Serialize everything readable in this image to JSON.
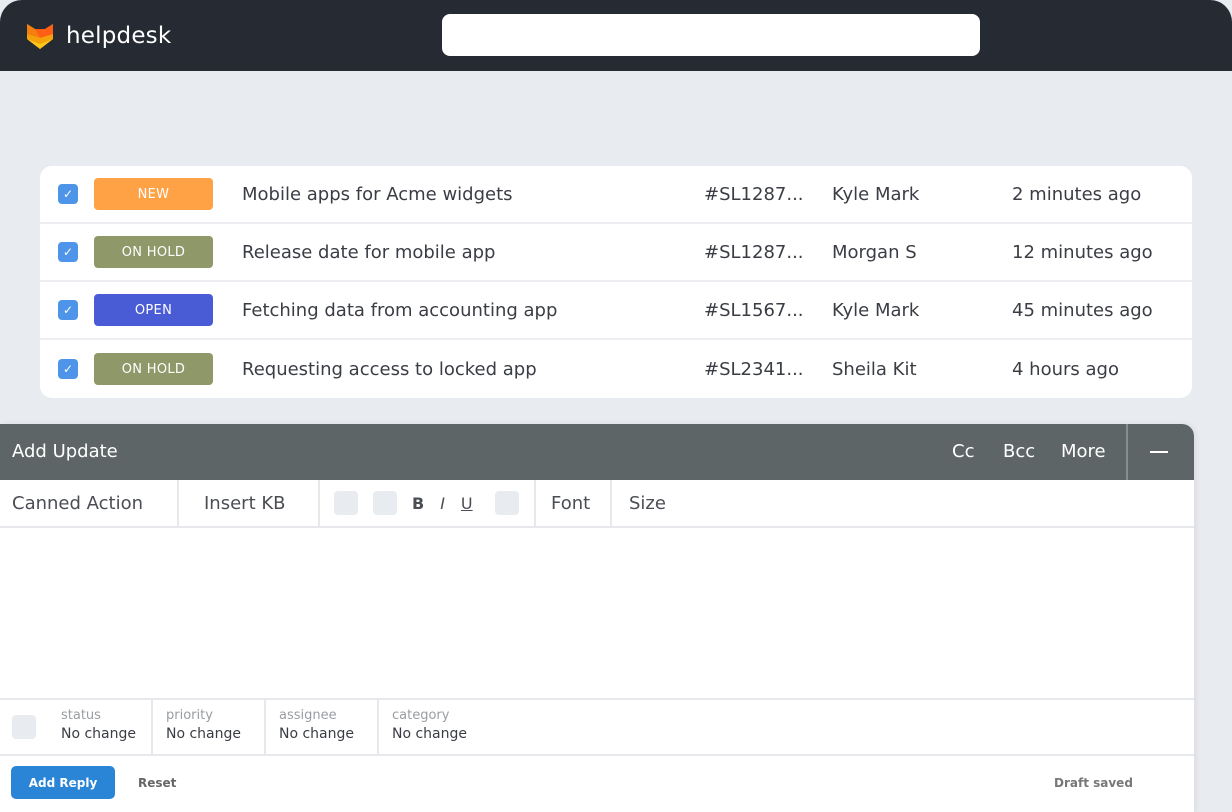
{
  "app": {
    "name": "helpdesk",
    "search": {
      "value": "",
      "placeholder": ""
    }
  },
  "tickets": [
    {
      "checked": true,
      "status": "NEW",
      "status_color": "#ffa245",
      "subject": "Mobile apps for Acme widgets",
      "id": "#SL1287...",
      "assignee": "Kyle Mark",
      "time": "2 minutes ago"
    },
    {
      "checked": true,
      "status": "ON HOLD",
      "status_color": "#8e9868",
      "subject": "Release date for mobile app",
      "id": "#SL1287...",
      "assignee": "Morgan S",
      "time": "12 minutes ago"
    },
    {
      "checked": true,
      "status": "OPEN",
      "status_color": "#4a5bd6",
      "subject": "Fetching data from accounting app",
      "id": "#SL1567...",
      "assignee": "Kyle Mark",
      "time": "45 minutes ago"
    },
    {
      "checked": true,
      "status": "ON HOLD",
      "status_color": "#8e9868",
      "subject": "Requesting access to locked app",
      "id": "#SL2341...",
      "assignee": "Sheila Kit",
      "time": "4 hours ago"
    }
  ],
  "compose": {
    "title": "Add Update",
    "cc": "Cc",
    "bcc": "Bcc",
    "more": "More",
    "toolbar": {
      "canned": "Canned Action",
      "kb": "Insert KB",
      "bold": "B",
      "italic": "I",
      "underline": "U",
      "font": "Font",
      "size": "Size"
    },
    "fields": [
      {
        "label": "status",
        "value": "No change"
      },
      {
        "label": "priority",
        "value": "No change"
      },
      {
        "label": "assignee",
        "value": "No change"
      },
      {
        "label": "category",
        "value": "No change"
      }
    ],
    "add_reply": "Add Reply",
    "reset": "Reset",
    "draft_status": "Draft saved"
  }
}
